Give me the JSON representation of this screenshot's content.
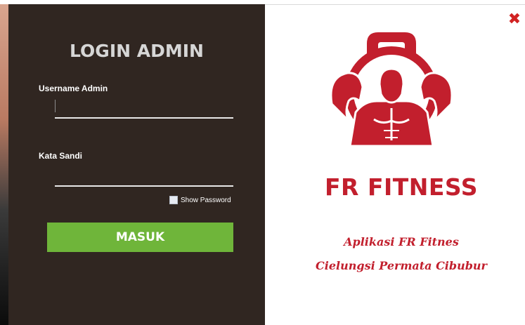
{
  "login": {
    "title": "LOGIN ADMIN",
    "username_label": "Username Admin",
    "username_value": "",
    "password_label": "Kata Sandi",
    "password_value": "",
    "show_password_label": "Show Password",
    "show_password_checked": false,
    "submit_label": "MASUK"
  },
  "brand": {
    "name": "FR FITNESS",
    "tagline_line1": "Aplikasi FR Fitnes",
    "tagline_line2": "Cielungsi Permata Cibubur",
    "logo_icon": "gym-kettlebell-muscleman-logo",
    "color": "#c21f2d"
  },
  "window": {
    "close_icon": "close-icon",
    "close_glyph": "✖"
  },
  "colors": {
    "left_panel": "#302621",
    "button": "#6fb53a",
    "close": "#d12222"
  }
}
